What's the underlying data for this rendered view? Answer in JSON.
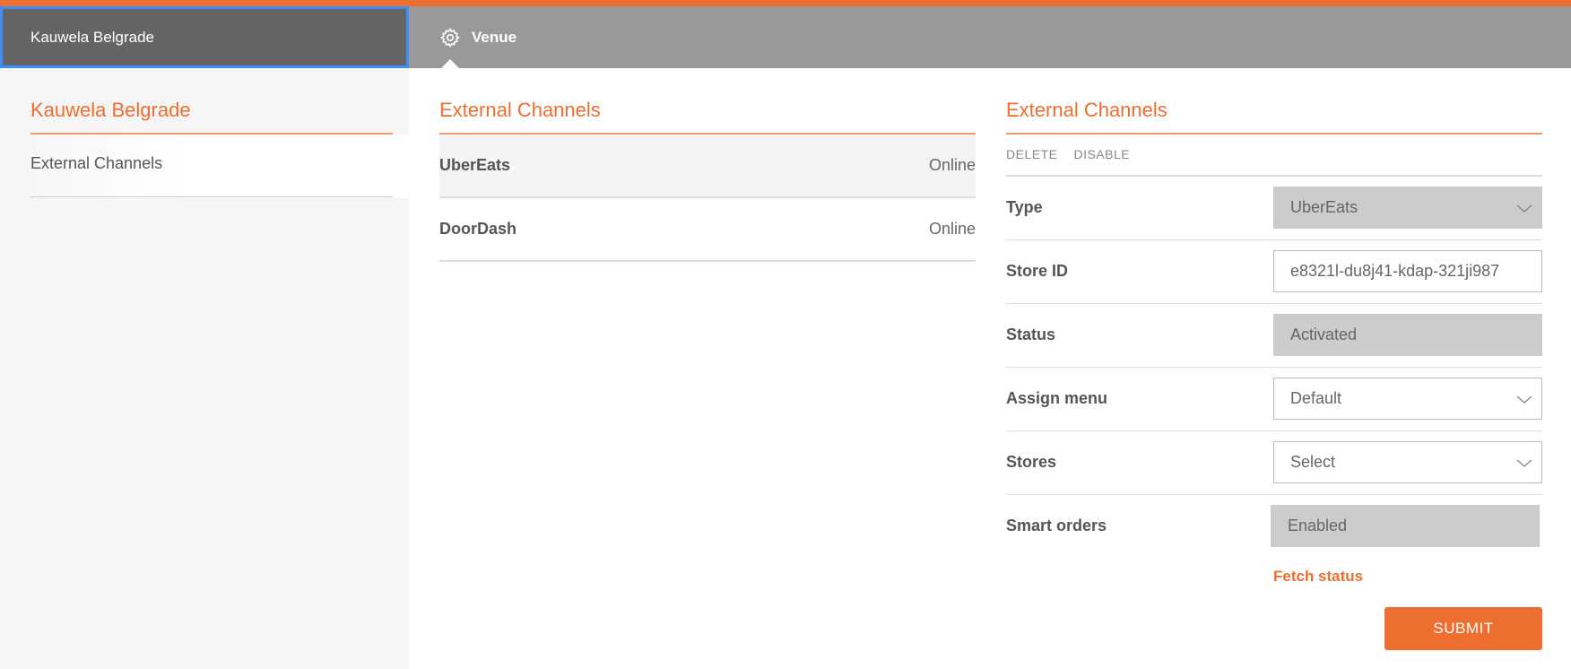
{
  "colors": {
    "accent": "#ee6e2f",
    "topbar": "#999999",
    "venue_switch": "#646464",
    "focus_outline": "#3d8ff5"
  },
  "topbar": {
    "venue_name": "Kauwela Belgrade",
    "tab_label": "Venue",
    "tab_icon": "gear-icon"
  },
  "sidebar": {
    "title": "Kauwela Belgrade",
    "items": [
      {
        "label": "External Channels"
      }
    ]
  },
  "channels": {
    "title": "External Channels",
    "rows": [
      {
        "name": "UberEats",
        "status": "Online"
      },
      {
        "name": "DoorDash",
        "status": "Online"
      }
    ]
  },
  "form": {
    "title": "External Channels",
    "delete_label": "DELETE",
    "disable_label": "DISABLE",
    "fields": {
      "type": {
        "label": "Type",
        "value": "UberEats"
      },
      "store_id": {
        "label": "Store ID",
        "value": "e8321l-du8j41-kdap-321ji987"
      },
      "status": {
        "label": "Status",
        "value": "Activated"
      },
      "assign_menu": {
        "label": "Assign menu",
        "value": "Default"
      },
      "stores": {
        "label": "Stores",
        "value": "Select"
      },
      "smart_orders": {
        "label": "Smart orders",
        "value": "Enabled"
      }
    },
    "fetch_status_label": "Fetch status",
    "submit_label": "SUBMIT"
  }
}
